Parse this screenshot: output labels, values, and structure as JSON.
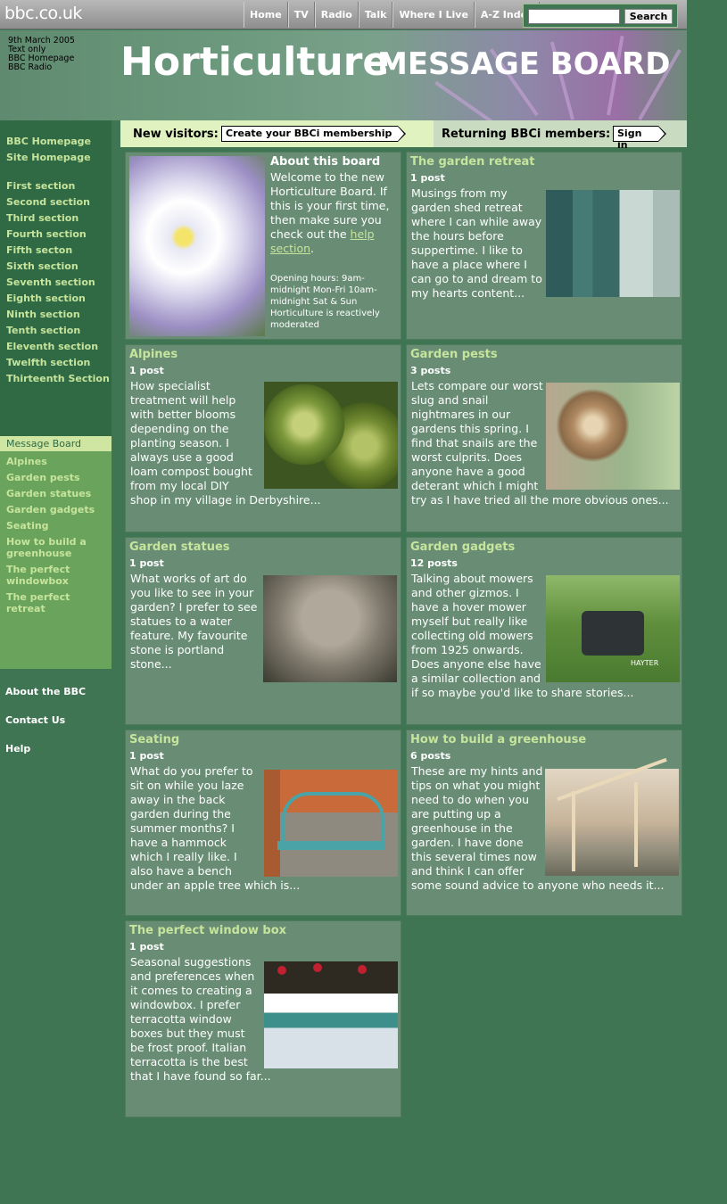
{
  "topbar": {
    "logo": "bbc.co.uk",
    "nav": [
      "Home",
      "TV",
      "Radio",
      "Talk",
      "Where I Live",
      "A-Z Index"
    ],
    "search_button": "Search",
    "search_value": ""
  },
  "header": {
    "date": "9th March 2005",
    "links": [
      "Text only",
      "BBC Homepage",
      "BBC Radio"
    ],
    "title": "Horticulture",
    "subtitle": "MESSAGE BOARD"
  },
  "sidebar": {
    "top_links": [
      "BBC Homepage",
      "Site Homepage"
    ],
    "sections": [
      "First section",
      "Second section",
      "Third section",
      "Fourth section",
      "Fifth secton",
      "Sixth section",
      "Seventh section",
      "Eighth section",
      "Ninth section",
      "Tenth section",
      "Eleventh section",
      "Twelfth section",
      "Thirteenth Section"
    ],
    "current": "Message Board",
    "board_links": [
      "Alpines",
      "Garden pests",
      "Garden statues",
      "Garden gadgets",
      "Seating",
      "How to build a greenhouse",
      "The perfect windowbox",
      "The perfect retreat"
    ],
    "bottom_links": [
      "About the BBC",
      "Contact Us",
      "Help"
    ]
  },
  "membership": {
    "new_label": "New visitors:",
    "new_button": "Create your BBCi membership",
    "return_label": "Returning BBCi members:",
    "return_button": "Sign in"
  },
  "about": {
    "title": "About this board",
    "body": "Welcome to the new Horticulture Board. If this is your first time, then make sure you check out the",
    "link": "help section",
    "link_suffix": ".",
    "small": "Opening hours: 9am-midnight Mon-Fri 10am-midnight Sat & Sun Horticulture is reactively moderated",
    "image_icon": "flower-image"
  },
  "boards": [
    {
      "title": "The garden retreat",
      "posts": "1 post",
      "text": "Musings from my garden shed retreat where I can while away the hours before suppertime. I like to have a place where I can go to and dream to my hearts content...",
      "image": "shed-door-image"
    },
    {
      "title": "Alpines",
      "posts": "1 post",
      "text": "How specialist treatment will help with better blooms depending on the planting season. I always use a good loam compost bought from my local DIY shop in my village in Derbyshire...",
      "image": "alpine-plant-image"
    },
    {
      "title": "Garden pests",
      "posts": "3 posts",
      "text": "Lets compare our worst slug and snail nightmares in our gardens this spring. I find that snails are the worst culprits. Does anyone have a good deterant which I might try as I have tried all the more obvious ones...",
      "image": "snail-image"
    },
    {
      "title": "Garden statues",
      "posts": "1 post",
      "text": "What works of art do you like to see in your garden? I prefer to see statues to a water feature. My favourite stone is portland stone...",
      "image": "statue-image"
    },
    {
      "title": "Garden gadgets",
      "posts": "12 posts",
      "text": "Talking about mowers and other gizmos. I have a hover mower myself but really like collecting old mowers from 1925 onwards. Does anyone else have a similar collection and if so maybe you'd like to share stories...",
      "image": "lawn-mower-image",
      "mower_brand": "HAYTER"
    },
    {
      "title": "Seating",
      "posts": "1 post",
      "text": "What do you prefer to sit on while you laze away in the back garden during the summer months? I have a hammock which I really like. I also have a bench under an apple tree which is...",
      "image": "bench-image"
    },
    {
      "title": "How to build a greenhouse",
      "posts": "6 posts",
      "text": "These are my hints and tips on what you might need to do when you are putting up a greenhouse in the garden. I have done this several times now and think I can offer some sound advice to anyone who needs it...",
      "image": "greenhouse-frame-image"
    },
    {
      "title": "The perfect window box",
      "posts": "1 post",
      "text": "Seasonal suggestions and preferences when it comes to creating a windowbox. I prefer terracotta window boxes but they must be frost proof. Italian terracotta is the best that I have found so far...",
      "image": "window-box-image"
    }
  ]
}
